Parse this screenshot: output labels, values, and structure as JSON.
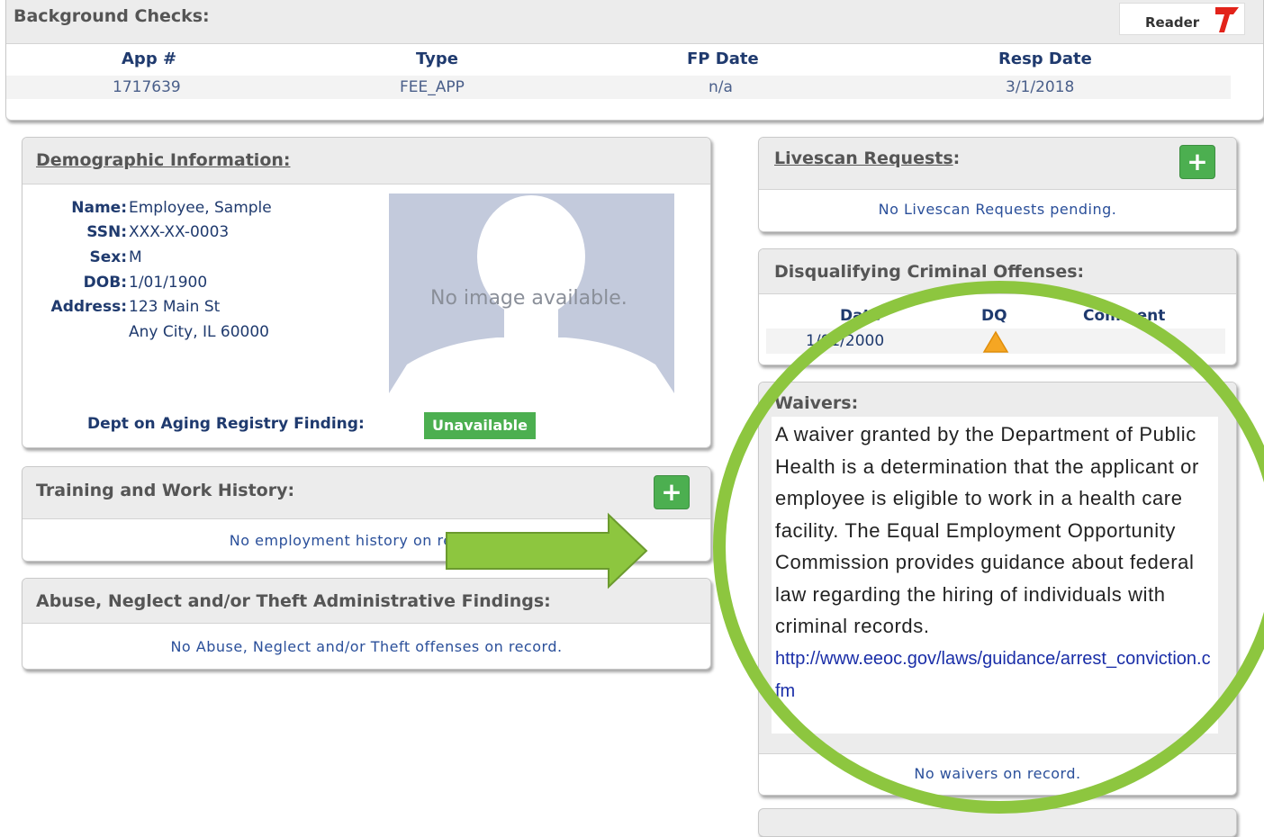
{
  "background_checks": {
    "title": "Background Checks:",
    "reader_label": "Reader",
    "columns": [
      "App #",
      "Type",
      "FP Date",
      "Resp Date"
    ],
    "rows": [
      [
        "1717639",
        "FEE_APP",
        "n/a",
        "3/1/2018"
      ]
    ]
  },
  "demographic": {
    "title": "Demographic Information:",
    "name_label": "Name:",
    "name": "Employee, Sample",
    "ssn_label": "SSN:",
    "ssn": "XXX-XX-0003",
    "sex_label": "Sex:",
    "sex": "M",
    "dob_label": "DOB:",
    "dob": "1/01/1900",
    "address_label": "Address:",
    "address_line1": "123 Main St",
    "address_line2": "Any City, IL 60000",
    "no_image": "No image available.",
    "registry_label": "Dept on Aging Registry Finding:",
    "registry_status": "Unavailable"
  },
  "training": {
    "title": "Training and Work History:",
    "add_label": "+",
    "empty_msg": "No employment history on record."
  },
  "abuse": {
    "title": "Abuse, Neglect and/or Theft Administrative Findings:",
    "empty_msg": "No Abuse, Neglect and/or Theft offenses on record."
  },
  "livescan": {
    "title": "Livescan Requests",
    "title_suffix": ":",
    "add_label": "+",
    "empty_msg": "No Livescan Requests pending."
  },
  "disqualifying": {
    "title": "Disqualifying Criminal Offenses:",
    "columns": [
      "Date",
      "DQ",
      "Comment"
    ],
    "row": {
      "date": "1/01/2000",
      "dq_icon": "warning-icon",
      "comment": ""
    }
  },
  "waivers": {
    "title": "Waivers:",
    "text": "A waiver granted by the Department of Public Health is a determination that the applicant or employee is eligible to work in a health care facility. The Equal Employment Opportunity Commission provides guidance about federal law regarding the hiring of individuals with criminal records.",
    "link": "http://www.eeoc.gov/laws/guidance/arrest_conviction.cfm",
    "empty_msg": "No waivers on record."
  },
  "colors": {
    "annotation_green": "#8dc63f",
    "button_green": "#4caf50",
    "badge_green": "#4caf50",
    "header_gray": "#ececec",
    "text_blue": "#1f3a6e"
  }
}
